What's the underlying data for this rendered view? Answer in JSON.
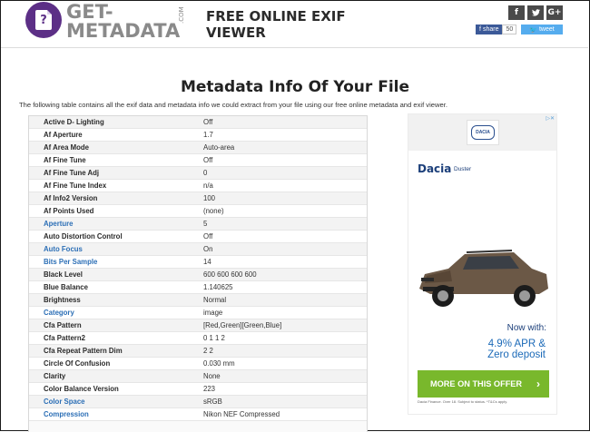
{
  "header": {
    "logo_line1": "GET-",
    "logo_line2": "METADATA",
    "logo_com": ".COM",
    "logo_glyph": "?",
    "title_line1": "FREE ONLINE EXIF",
    "title_line2": "VIEWER",
    "social": {
      "facebook_icon": "f",
      "twitter_icon": "🐦",
      "google_icon": "G+",
      "share_label": "share",
      "share_count": "50",
      "tweet_label": "tweet"
    }
  },
  "main": {
    "page_title": "Metadata Info Of Your File",
    "intro": "The following table contains all the exif data and metadata info we could extract from your file using our free online metadata and exif viewer.",
    "rows": [
      {
        "key": "Active D- Lighting",
        "value": "Off",
        "link": false
      },
      {
        "key": "Af Aperture",
        "value": "1.7",
        "link": false
      },
      {
        "key": "Af Area Mode",
        "value": "Auto-area",
        "link": false
      },
      {
        "key": "Af Fine Tune",
        "value": "Off",
        "link": false
      },
      {
        "key": "Af Fine Tune Adj",
        "value": "0",
        "link": false
      },
      {
        "key": "Af Fine Tune Index",
        "value": "n/a",
        "link": false
      },
      {
        "key": "Af Info2 Version",
        "value": "100",
        "link": false
      },
      {
        "key": "Af Points Used",
        "value": "(none)",
        "link": false
      },
      {
        "key": "Aperture",
        "value": "5",
        "link": true
      },
      {
        "key": "Auto Distortion Control",
        "value": "Off",
        "link": false
      },
      {
        "key": "Auto Focus",
        "value": "On",
        "link": true
      },
      {
        "key": "Bits Per Sample",
        "value": "14",
        "link": true
      },
      {
        "key": "Black Level",
        "value": "600 600 600 600",
        "link": false
      },
      {
        "key": "Blue Balance",
        "value": "1.140625",
        "link": false
      },
      {
        "key": "Brightness",
        "value": "Normal",
        "link": false
      },
      {
        "key": "Category",
        "value": "image",
        "link": true
      },
      {
        "key": "Cfa Pattern",
        "value": "[Red,Green][Green,Blue]",
        "link": false
      },
      {
        "key": "Cfa Pattern2",
        "value": "0 1 1 2",
        "link": false
      },
      {
        "key": "Cfa Repeat Pattern Dim",
        "value": "2 2",
        "link": false
      },
      {
        "key": "Circle Of Confusion",
        "value": "0.030 mm",
        "link": false
      },
      {
        "key": "Clarity",
        "value": "None",
        "link": false
      },
      {
        "key": "Color Balance Version",
        "value": "223",
        "link": false
      },
      {
        "key": "Color Space",
        "value": "sRGB",
        "link": true
      },
      {
        "key": "Compression",
        "value": "Nikon NEF Compressed",
        "link": true
      }
    ]
  },
  "ad": {
    "badge": "DACIA",
    "close": "▷✕",
    "brand": "Dacia",
    "model": "Duster",
    "now_with": "Now with:",
    "apr_line1": "4.9% APR &",
    "apr_line2": "Zero deposit",
    "cta": "MORE ON THIS OFFER",
    "cta_chevron": "›",
    "fine_print": "Dacia Finance. Over 18. Subject to status. *T&Cs apply."
  },
  "colors": {
    "logo_purple": "#5c2f86",
    "link_blue": "#2c6fb6",
    "facebook": "#3b5998",
    "twitter": "#55acee",
    "ad_green": "#79b82c",
    "ad_navy": "#1c3f7a"
  }
}
